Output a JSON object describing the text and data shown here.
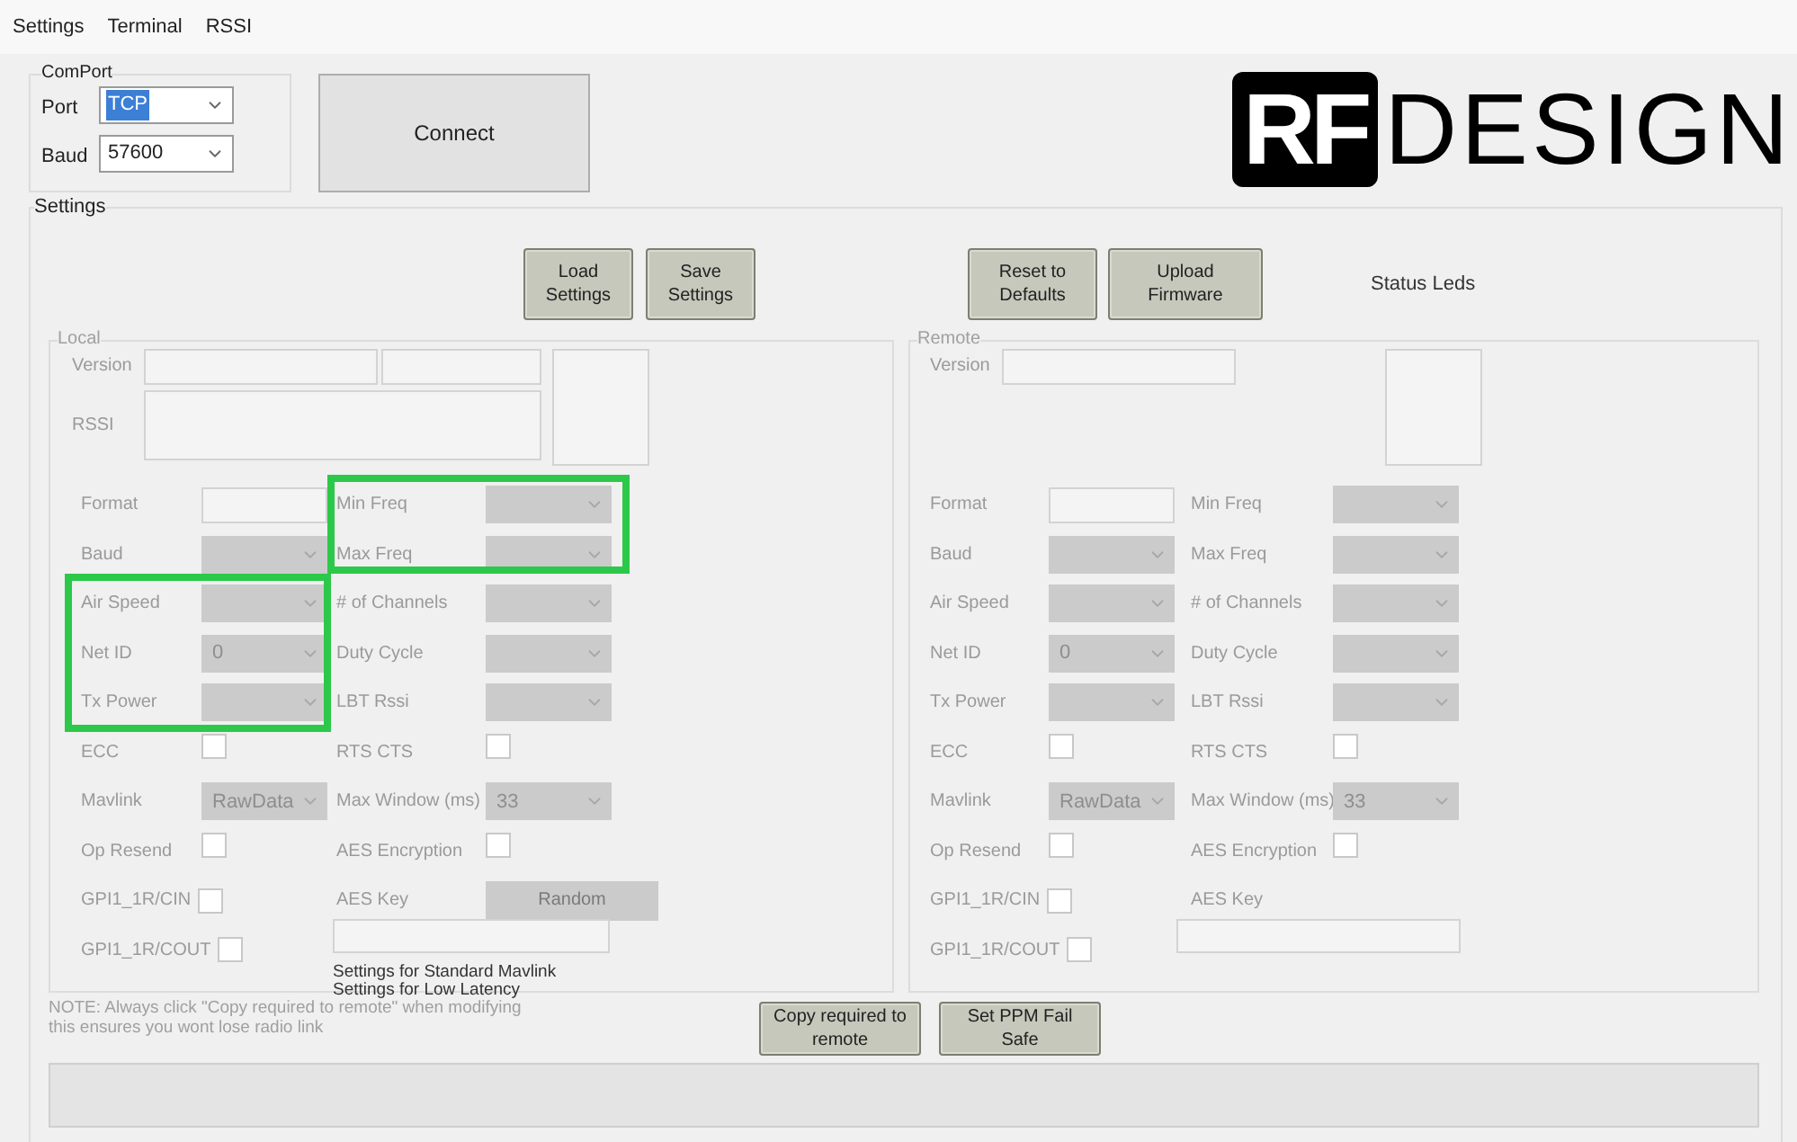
{
  "menu": [
    {
      "label": "Settings"
    },
    {
      "label": "Terminal"
    },
    {
      "label": "RSSI"
    }
  ],
  "comport": {
    "title": "ComPort",
    "port": {
      "label": "Port",
      "value": "TCP",
      "highlighted": true
    },
    "baud": {
      "label": "Baud",
      "value": "57600",
      "highlighted": false
    }
  },
  "connect_button": "Connect",
  "logo": {
    "mark": "RF",
    "word": "DESIGN"
  },
  "settings": {
    "title": "Settings",
    "file_buttons": [
      "Load Settings",
      "Save Settings"
    ],
    "device_buttons": [
      "Reset to Defaults",
      "Upload Firmware"
    ],
    "status_leds": "Status Leds"
  },
  "local": {
    "title": "Local",
    "version_label": "Version",
    "rssi_label": "RSSI",
    "left": [
      {
        "kind": "text",
        "label": "Format"
      },
      {
        "kind": "select",
        "label": "Baud"
      },
      {
        "kind": "select",
        "label": "Air Speed"
      },
      {
        "kind": "select",
        "label": "Net ID",
        "value": "0"
      },
      {
        "kind": "select",
        "label": "Tx Power"
      },
      {
        "kind": "checkbox",
        "label": "ECC",
        "checked": false
      },
      {
        "kind": "select",
        "label": "Mavlink",
        "value": "RawData"
      },
      {
        "kind": "checkbox",
        "label": "Op Resend",
        "checked": false
      },
      {
        "kind": "inline_checkbox",
        "label": "GPI1_1R/CIN",
        "checked": false
      },
      {
        "kind": "inline_checkbox",
        "label": "GPI1_1R/COUT",
        "checked": false
      }
    ],
    "right": [
      {
        "kind": "select",
        "label": "Min Freq"
      },
      {
        "kind": "select",
        "label": "Max Freq"
      },
      {
        "kind": "select",
        "label": "# of Channels"
      },
      {
        "kind": "select",
        "label": "Duty Cycle"
      },
      {
        "kind": "select",
        "label": "LBT Rssi"
      },
      {
        "kind": "checkbox",
        "label": "RTS CTS",
        "checked": false
      },
      {
        "kind": "select",
        "label": "Max Window (ms)",
        "value": "33"
      },
      {
        "kind": "checkbox",
        "label": "AES Encryption",
        "checked": false
      },
      {
        "kind": "key",
        "label": "AES Key",
        "button": "Random"
      }
    ],
    "presets": [
      "Settings for Standard Mavlink",
      "Settings for Low Latency"
    ]
  },
  "remote": {
    "title": "Remote",
    "version_label": "Version",
    "left": [
      {
        "kind": "text",
        "label": "Format"
      },
      {
        "kind": "select",
        "label": "Baud"
      },
      {
        "kind": "select",
        "label": "Air Speed"
      },
      {
        "kind": "select",
        "label": "Net ID",
        "value": "0"
      },
      {
        "kind": "select",
        "label": "Tx Power"
      },
      {
        "kind": "checkbox",
        "label": "ECC",
        "checked": false
      },
      {
        "kind": "select",
        "label": "Mavlink",
        "value": "RawData"
      },
      {
        "kind": "checkbox",
        "label": "Op Resend",
        "checked": false
      },
      {
        "kind": "inline_checkbox",
        "label": "GPI1_1R/CIN",
        "checked": false
      },
      {
        "kind": "inline_checkbox",
        "label": "GPI1_1R/COUT",
        "checked": false
      }
    ],
    "right": [
      {
        "kind": "select",
        "label": "Min Freq"
      },
      {
        "kind": "select",
        "label": "Max Freq"
      },
      {
        "kind": "select",
        "label": "# of Channels"
      },
      {
        "kind": "select",
        "label": "Duty Cycle"
      },
      {
        "kind": "select",
        "label": "LBT Rssi"
      },
      {
        "kind": "checkbox",
        "label": "RTS CTS",
        "checked": false
      },
      {
        "kind": "select",
        "label": "Max Window (ms)",
        "value": "33"
      },
      {
        "kind": "checkbox",
        "label": "AES Encryption",
        "checked": false
      },
      {
        "kind": "key",
        "label": "AES Key"
      }
    ]
  },
  "note": [
    "NOTE: Always click \"Copy required to remote\" when modifying",
    "this ensures you wont lose radio link"
  ],
  "bottom_buttons": [
    "Copy required to remote",
    "Set PPM Fail Safe"
  ]
}
